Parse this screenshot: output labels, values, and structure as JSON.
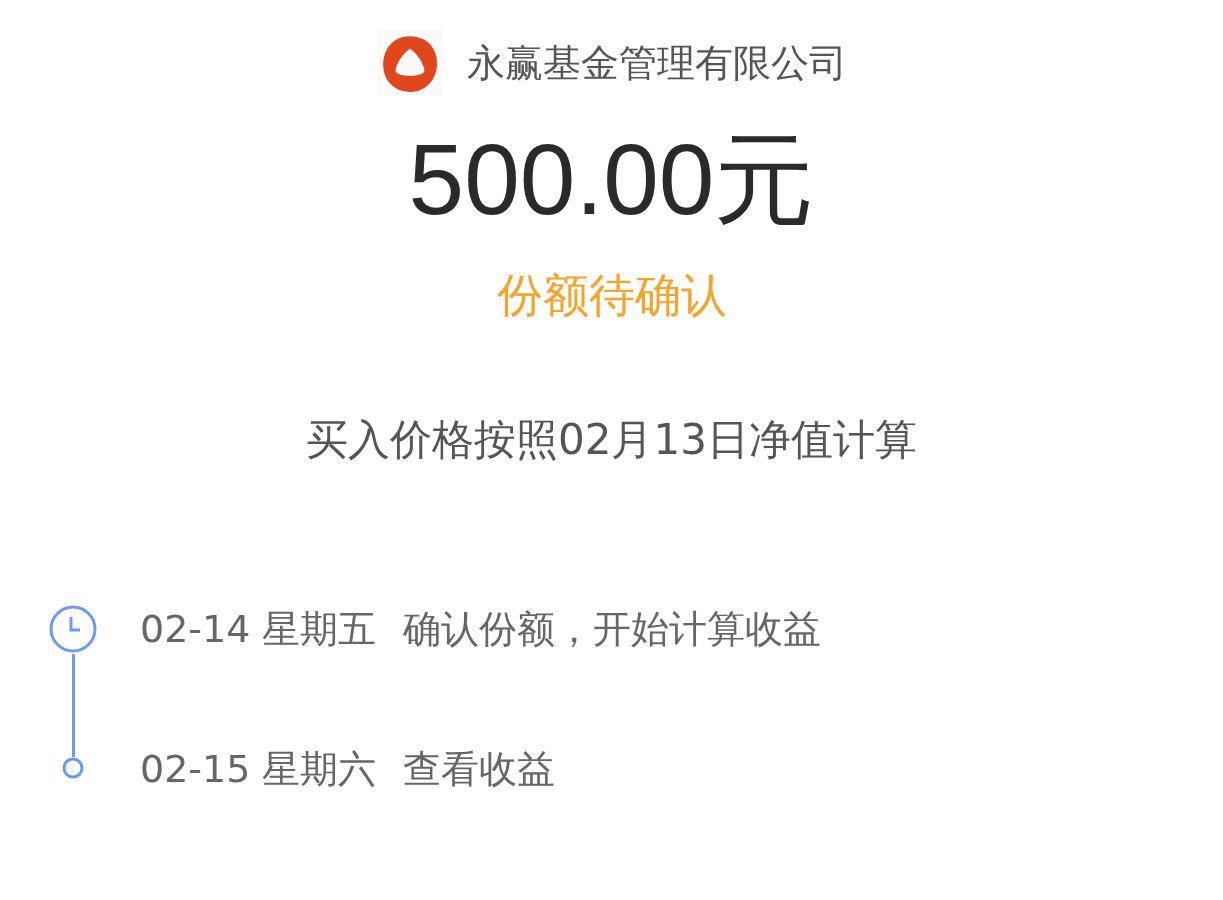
{
  "company": {
    "name": "永赢基金管理有限公司"
  },
  "amount": "500.00元",
  "status": "份额待确认",
  "note": "买入价格按照02月13日净值计算",
  "timeline": [
    {
      "kind": "clock",
      "date": "02-14 星期五",
      "action": "确认份额，开始计算收益"
    },
    {
      "kind": "dot",
      "date": "02-15 星期六",
      "action": "查看收益"
    }
  ]
}
